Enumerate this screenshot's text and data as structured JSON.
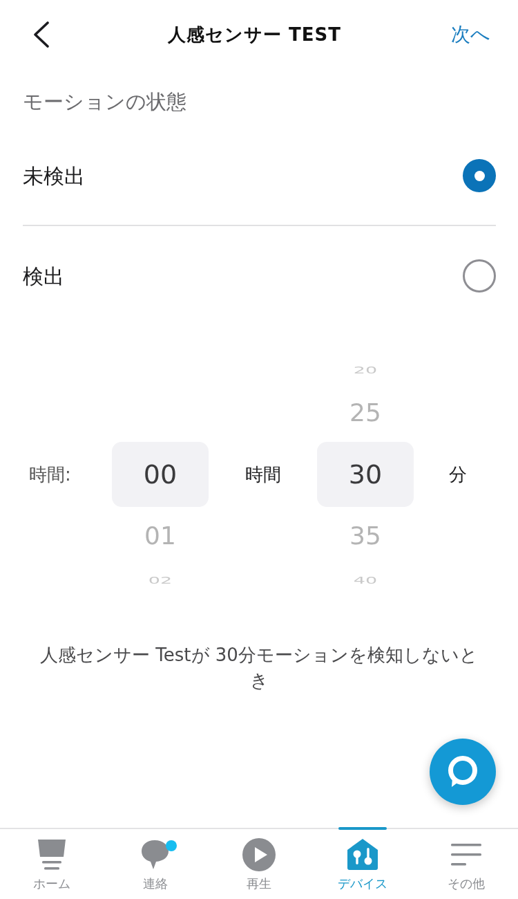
{
  "header": {
    "title": "人感センサー TEST",
    "next": "次へ"
  },
  "motion_state": {
    "heading": "モーションの状態",
    "options": [
      {
        "label": "未検出",
        "selected": true
      },
      {
        "label": "検出",
        "selected": false
      }
    ]
  },
  "duration_picker": {
    "label": "時間:",
    "wheels": [
      {
        "unit": "時間",
        "items": [
          {
            "value": "00",
            "selected": true
          },
          {
            "value": "01",
            "selected": false
          },
          {
            "value": "02",
            "selected": false
          }
        ]
      },
      {
        "unit": "分",
        "items": [
          {
            "value": "20",
            "selected": false
          },
          {
            "value": "25",
            "selected": false
          },
          {
            "value": "30",
            "selected": true
          },
          {
            "value": "35",
            "selected": false
          },
          {
            "value": "40",
            "selected": false
          }
        ]
      }
    ]
  },
  "description": "人感センサー Testが 30分モーションを検知しないとき",
  "tab_bar": {
    "tabs": [
      {
        "label": "ホーム",
        "selected": false,
        "notification": false
      },
      {
        "label": "連絡",
        "selected": false,
        "notification": true
      },
      {
        "label": "再生",
        "selected": false,
        "notification": false
      },
      {
        "label": "デバイス",
        "selected": true,
        "notification": false
      },
      {
        "label": "その他",
        "selected": false,
        "notification": false
      }
    ]
  }
}
